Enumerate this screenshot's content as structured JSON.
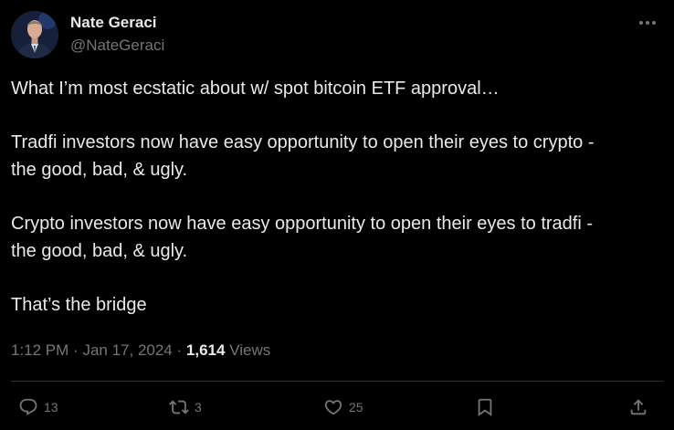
{
  "author": {
    "display_name": "Nate Geraci",
    "handle": "@NateGeraci",
    "avatar_icon": "user-avatar"
  },
  "tweet": {
    "paragraphs": [
      "What I’m most ecstatic about w/ spot bitcoin ETF approval…",
      "Tradfi investors now have easy opportunity to open their eyes to crypto -\nthe good, bad, & ugly.",
      "Crypto investors now have easy opportunity to open their eyes to tradfi -\nthe good, bad, & ugly.",
      "That’s the bridge"
    ],
    "time": "1:12 PM",
    "separator": "·",
    "date": "Jan 17, 2024",
    "views_count": "1,614",
    "views_label": "Views"
  },
  "actions": {
    "reply_count": "13",
    "repost_count": "3",
    "like_count": "25",
    "reply_icon": "reply-icon",
    "repost_icon": "repost-icon",
    "like_icon": "heart-icon",
    "bookmark_icon": "bookmark-icon",
    "share_icon": "share-icon"
  },
  "colors": {
    "background": "#000000",
    "text_primary": "#e7e9ea",
    "text_secondary": "#71767b",
    "divider": "#2f3336"
  }
}
